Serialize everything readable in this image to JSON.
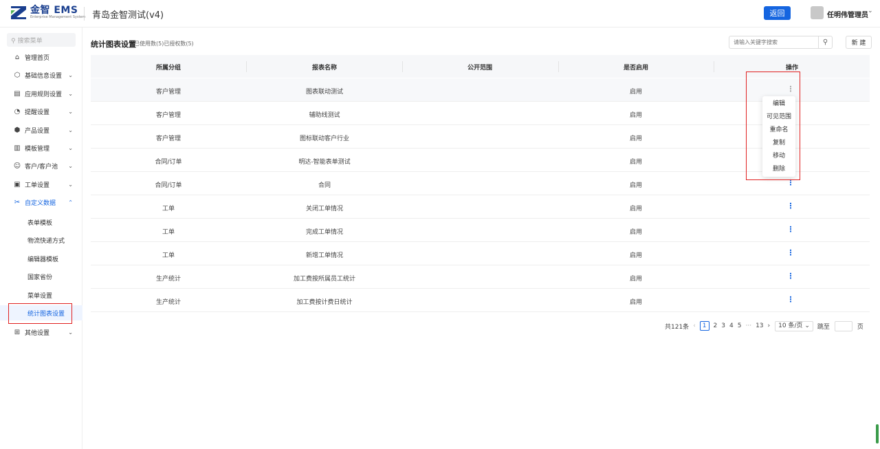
{
  "header": {
    "logo_main": "金智 EMS",
    "logo_sub": "Enterprise Management System",
    "title": "青岛金智测试(v4)",
    "back_label": "返回",
    "user_name": "任明伟管理员",
    "brand_color": "#1565e0"
  },
  "sidebar": {
    "search_placeholder": "搜索菜单",
    "items": [
      {
        "label": "管理首页",
        "icon": "home-icon"
      },
      {
        "label": "基础信息设置",
        "icon": "cube-icon"
      },
      {
        "label": "应用规则设置",
        "icon": "doc-icon"
      },
      {
        "label": "提醒设置",
        "icon": "bell-icon"
      },
      {
        "label": "产品设置",
        "icon": "box-icon"
      },
      {
        "label": "模板管理",
        "icon": "template-icon"
      },
      {
        "label": "客户/客户池",
        "icon": "users-icon"
      },
      {
        "label": "工单设置",
        "icon": "ticket-icon"
      },
      {
        "label": "自定义数据",
        "icon": "tools-icon"
      },
      {
        "label": "其他设置",
        "icon": "grid-icon"
      }
    ],
    "sub_items": [
      "表单模板",
      "物流快递方式",
      "编辑器模板",
      "国家省份",
      "菜单设置",
      "统计图表设置"
    ]
  },
  "main": {
    "title": "统计图表设置",
    "subtitle": "已使用数(5)已授权数(5)",
    "search_placeholder": "请输入关键字搜索",
    "new_label": "新 建"
  },
  "table": {
    "columns": [
      "所属分组",
      "报表名称",
      "公开范围",
      "是否启用",
      "操作"
    ],
    "rows": [
      {
        "group": "客户管理",
        "name": "图表联动测试",
        "scope": "",
        "enabled": "启用"
      },
      {
        "group": "客户管理",
        "name": "辅助线测试",
        "scope": "",
        "enabled": "启用"
      },
      {
        "group": "客户管理",
        "name": "图标联动客户行业",
        "scope": "",
        "enabled": "启用"
      },
      {
        "group": "合同/订单",
        "name": "明达-智能表单测试",
        "scope": "",
        "enabled": "启用"
      },
      {
        "group": "合同/订单",
        "name": "合同",
        "scope": "",
        "enabled": "启用"
      },
      {
        "group": "工单",
        "name": "关闭工单情况",
        "scope": "",
        "enabled": "启用"
      },
      {
        "group": "工单",
        "name": "完成工单情况",
        "scope": "",
        "enabled": "启用"
      },
      {
        "group": "工单",
        "name": "新增工单情况",
        "scope": "",
        "enabled": "启用"
      },
      {
        "group": "生产统计",
        "name": "加工费按所属员工统计",
        "scope": "",
        "enabled": "启用"
      },
      {
        "group": "生产统计",
        "name": "加工费按计费日统计",
        "scope": "",
        "enabled": "启用"
      }
    ],
    "op_glyph": "⋮"
  },
  "dropdown": {
    "items": [
      "编辑",
      "可见范围",
      "重命名",
      "复制",
      "移动",
      "删除"
    ]
  },
  "pager": {
    "total": "共121条",
    "prev": "‹",
    "pages": [
      "1",
      "2",
      "3",
      "4",
      "5"
    ],
    "ellipsis": "···",
    "last": "13",
    "next": "›",
    "page_size": "10 条/页",
    "jump_label": "跳至",
    "page_suffix": "页"
  }
}
